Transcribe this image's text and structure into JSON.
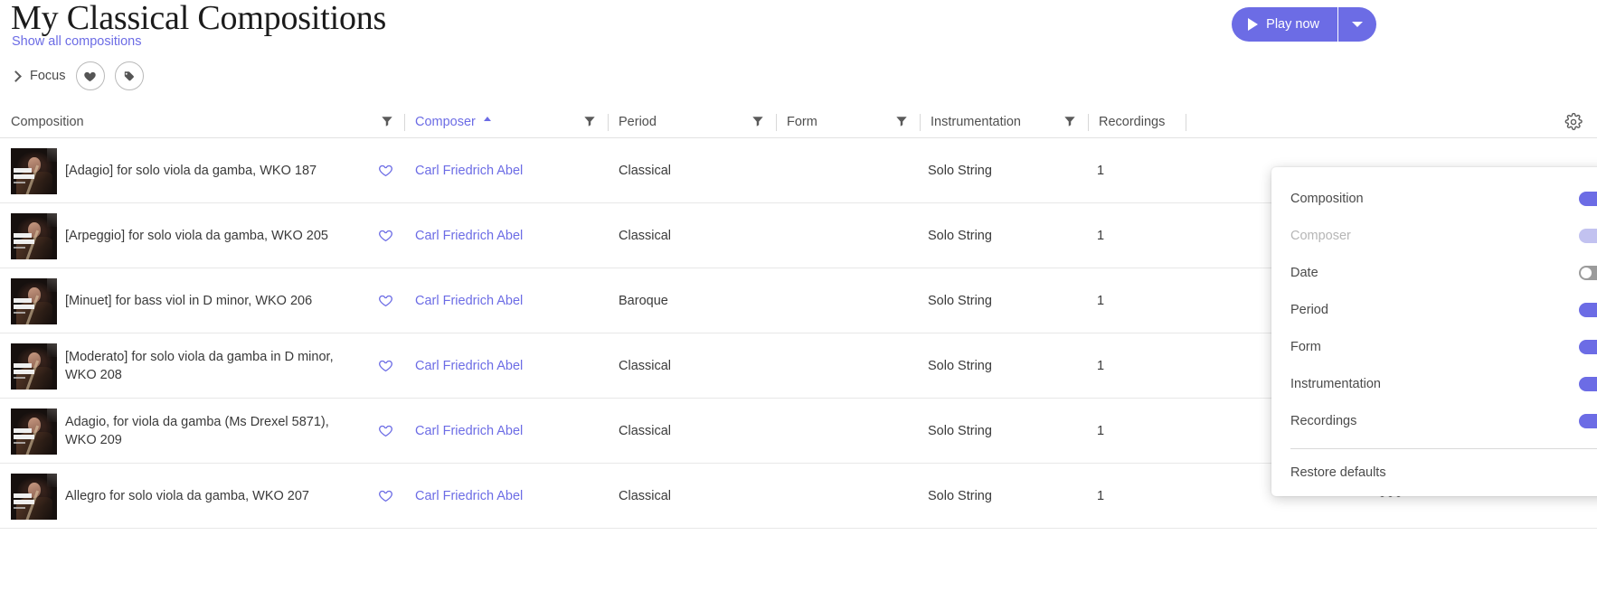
{
  "header": {
    "title": "My Classical Compositions",
    "show_all_link": "Show all compositions",
    "focus_label": "Focus",
    "favorite_icon": "heart-filled-icon",
    "tag_icon": "tag-icon",
    "play_button": "Play now",
    "play_icon": "play-triangle-icon",
    "play_dropdown_icon": "chevron-down-icon",
    "accent_color": "#6c6ce5"
  },
  "table": {
    "columns": [
      {
        "key": "composition",
        "label": "Composition",
        "filter": true,
        "sorted": false
      },
      {
        "key": "composer",
        "label": "Composer",
        "filter": true,
        "sorted": true,
        "sort_direction": "asc"
      },
      {
        "key": "period",
        "label": "Period",
        "filter": true,
        "sorted": false
      },
      {
        "key": "form",
        "label": "Form",
        "filter": true,
        "sorted": false
      },
      {
        "key": "instrumentation",
        "label": "Instrumentation",
        "filter": true,
        "sorted": false
      },
      {
        "key": "recordings",
        "label": "Recordings",
        "filter": false,
        "sorted": false
      }
    ],
    "settings_icon": "gear-icon",
    "rows": [
      {
        "composition": "[Adagio] for solo viola da gamba, WKO 187",
        "composer": "Carl Friedrich Abel",
        "period": "Classical",
        "form": "",
        "instrumentation": "Solo String",
        "recordings": "1",
        "favorite_icon": "heart-outline-icon",
        "thumbnail": "album-cover-thumbnail"
      },
      {
        "composition": "[Arpeggio] for solo viola da gamba, WKO 205",
        "composer": "Carl Friedrich Abel",
        "period": "Classical",
        "form": "",
        "instrumentation": "Solo String",
        "recordings": "1",
        "favorite_icon": "heart-outline-icon",
        "thumbnail": "album-cover-thumbnail"
      },
      {
        "composition": "[Minuet] for bass viol in D minor, WKO 206",
        "composer": "Carl Friedrich Abel",
        "period": "Baroque",
        "form": "",
        "instrumentation": "Solo String",
        "recordings": "1",
        "favorite_icon": "heart-outline-icon",
        "thumbnail": "album-cover-thumbnail"
      },
      {
        "composition": "[Moderato] for solo viola da gamba in D minor, WKO 208",
        "composer": "Carl Friedrich Abel",
        "period": "Classical",
        "form": "",
        "instrumentation": "Solo String",
        "recordings": "1",
        "favorite_icon": "heart-outline-icon",
        "thumbnail": "album-cover-thumbnail"
      },
      {
        "composition": "Adagio, for viola da gamba (Ms Drexel 5871), WKO 209",
        "composer": "Carl Friedrich Abel",
        "period": "Classical",
        "form": "",
        "instrumentation": "Solo String",
        "recordings": "1",
        "favorite_icon": "heart-outline-icon",
        "thumbnail": "album-cover-thumbnail"
      },
      {
        "composition": "Allegro for solo viola da gamba, WKO 207",
        "composer": "Carl Friedrich Abel",
        "period": "Classical",
        "form": "",
        "instrumentation": "Solo String",
        "recordings": "1",
        "favorite_icon": "heart-outline-icon",
        "thumbnail": "album-cover-thumbnail",
        "overflow_icon": "more-horizontal-icon"
      }
    ]
  },
  "settings_panel": {
    "items": [
      {
        "label": "Composition",
        "state": "on"
      },
      {
        "label": "Composer",
        "state": "disabled"
      },
      {
        "label": "Date",
        "state": "off"
      },
      {
        "label": "Period",
        "state": "on"
      },
      {
        "label": "Form",
        "state": "on"
      },
      {
        "label": "Instrumentation",
        "state": "on"
      },
      {
        "label": "Recordings",
        "state": "on"
      }
    ],
    "restore_label": "Restore defaults"
  }
}
